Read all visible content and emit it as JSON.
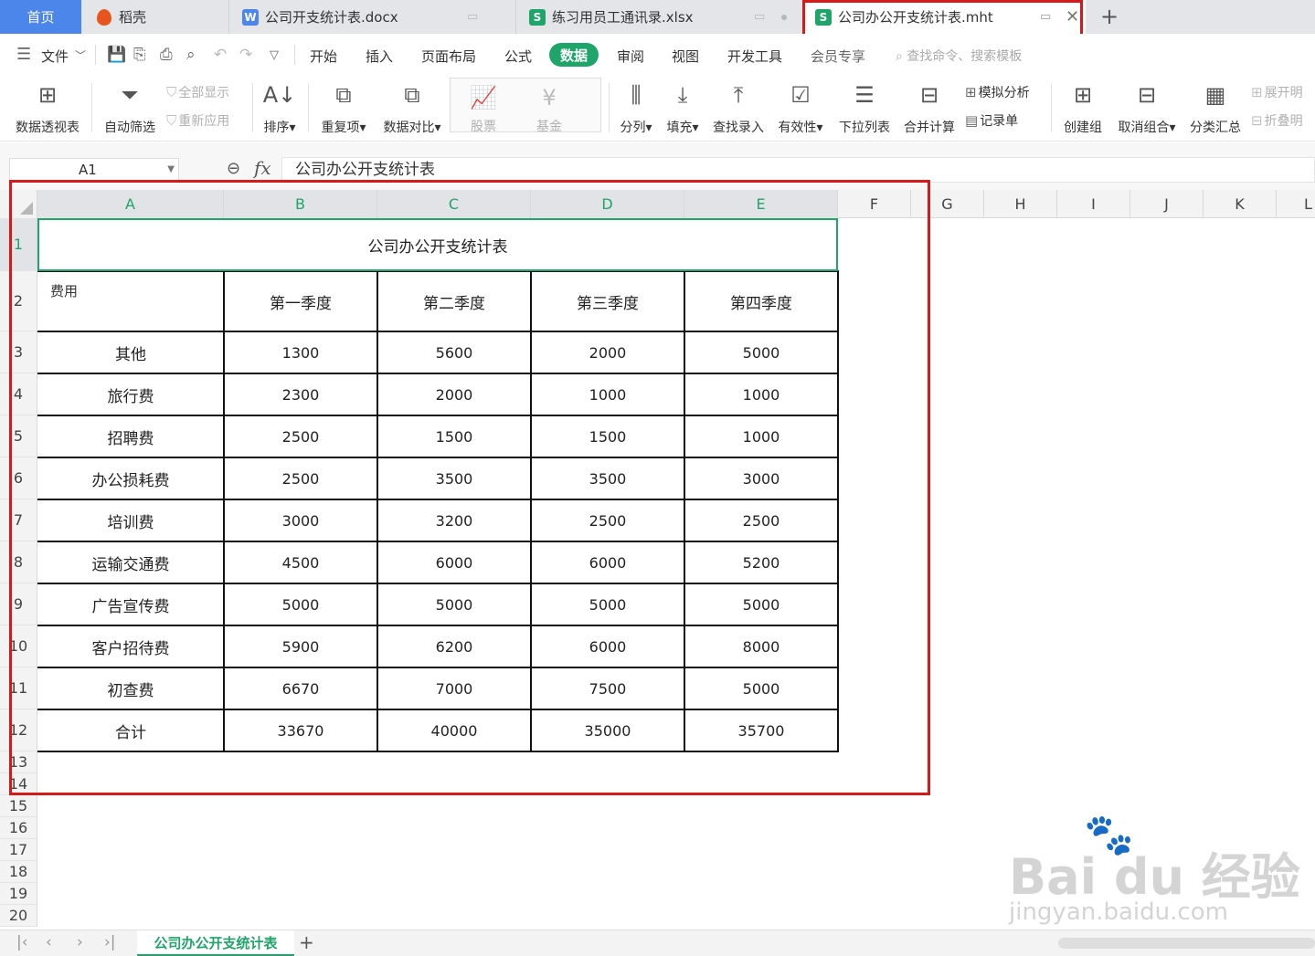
{
  "tabs": {
    "home": "首页",
    "daoke": "稻壳",
    "docx": "公司开支统计表.docx",
    "docx_icon": "W",
    "xlsx": "练习用员工通讯录.xlsx",
    "xlsx_icon": "S",
    "active": "公司办公开支统计表.mht",
    "active_icon": "S",
    "add": "+"
  },
  "menu": {
    "file": "文件",
    "items": [
      "开始",
      "插入",
      "页面布局",
      "公式",
      "数据",
      "审阅",
      "视图",
      "开发工具",
      "会员专享"
    ],
    "search_placeholder": "查找命令、搜索模板"
  },
  "ribbon": {
    "pivot": "数据透视表",
    "autofilter": "自动筛选",
    "show_all": "全部显示",
    "reapply": "重新应用",
    "sort": "排序",
    "duplicates": "重复项",
    "compare": "数据对比",
    "stock": "股票",
    "fund": "基金",
    "split": "分列",
    "fill": "填充",
    "lookup": "查找录入",
    "validity": "有效性",
    "dropdown": "下拉列表",
    "consolidate": "合并计算",
    "simulate": "模拟分析",
    "record": "记录单",
    "group": "创建组",
    "ungroup": "取消组合",
    "subtotal": "分类汇总",
    "expand": "展开明",
    "collapse": "折叠明"
  },
  "formula": {
    "name_box": "A1",
    "fx": "fx",
    "value": "公司办公开支统计表"
  },
  "grid": {
    "columns": [
      "A",
      "B",
      "C",
      "D",
      "E",
      "F",
      "G",
      "H",
      "I",
      "J",
      "K",
      "L"
    ],
    "rows": [
      "1",
      "2",
      "3",
      "4",
      "5",
      "6",
      "7",
      "8",
      "9",
      "10",
      "11",
      "12",
      "13",
      "14",
      "15",
      "16",
      "17",
      "18",
      "19",
      "20"
    ]
  },
  "sheet": {
    "title": "公司办公开支统计表",
    "fee_label": "费用",
    "quarters": [
      "第一季度",
      "第二季度",
      "第三季度",
      "第四季度"
    ],
    "data": [
      [
        "其他",
        "1300",
        "5600",
        "2000",
        "5000"
      ],
      [
        "旅行费",
        "2300",
        "2000",
        "1000",
        "1000"
      ],
      [
        "招聘费",
        "2500",
        "1500",
        "1500",
        "1000"
      ],
      [
        "办公损耗费",
        "2500",
        "3500",
        "3500",
        "3000"
      ],
      [
        "培训费",
        "3000",
        "3200",
        "2500",
        "2500"
      ],
      [
        "运输交通费",
        "4500",
        "6000",
        "6000",
        "5200"
      ],
      [
        "广告宣传费",
        "5000",
        "5000",
        "5000",
        "5000"
      ],
      [
        "客户招待费",
        "5900",
        "6200",
        "6000",
        "8000"
      ],
      [
        "初查费",
        "6670",
        "7000",
        "7500",
        "5000"
      ],
      [
        "合计",
        "33670",
        "40000",
        "35000",
        "35700"
      ]
    ]
  },
  "sheet_tab": "公司办公开支统计表",
  "watermark": {
    "logo": "Bai du 经验",
    "url": "jingyan.baidu.com"
  },
  "colors": {
    "accent": "#1fa56a",
    "annotation": "#d61a1a",
    "home_tab": "#4d86ea"
  }
}
